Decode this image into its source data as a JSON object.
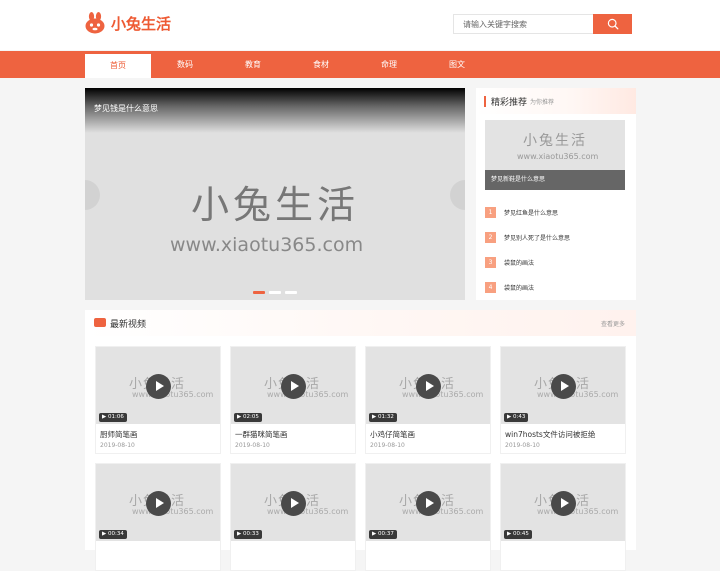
{
  "brand": {
    "name": "小兔生活"
  },
  "search": {
    "placeholder": "请输入关键字搜索"
  },
  "nav": [
    {
      "label": "首页",
      "active": true
    },
    {
      "label": "数码",
      "active": false
    },
    {
      "label": "教育",
      "active": false
    },
    {
      "label": "食材",
      "active": false
    },
    {
      "label": "命理",
      "active": false
    },
    {
      "label": "图文",
      "active": false
    }
  ],
  "slider": {
    "title": "梦见钱是什么意思",
    "watermark": "小兔生活",
    "watermark_url": "www.xiaotu365.com"
  },
  "recommend": {
    "title": "精彩推荐",
    "subtitle": "为你推荐",
    "featured_caption": "梦见新鞋是什么意思",
    "watermark": "小兔生活",
    "watermark_url": "www.xiaotu365.com",
    "items": [
      {
        "num": "1",
        "text": "梦见红鱼是什么意思"
      },
      {
        "num": "2",
        "text": "梦见别人死了是什么意思"
      },
      {
        "num": "3",
        "text": "袋鼠的画法"
      },
      {
        "num": "4",
        "text": "袋鼠的画法"
      }
    ]
  },
  "videos": {
    "title": "最新视频",
    "more": "查看更多",
    "watermark": "小兔生活",
    "watermark_url": "www.xiaotu365.com",
    "items": [
      {
        "duration": "01:06",
        "title": "厨师简笔画",
        "date": "2019-08-10"
      },
      {
        "duration": "02:05",
        "title": "一群猫咪简笔画",
        "date": "2019-08-10"
      },
      {
        "duration": "01:32",
        "title": "小鸡仔简笔画",
        "date": "2019-08-10"
      },
      {
        "duration": "0:43",
        "title": "win7hosts文件访问被拒绝",
        "date": "2019-08-10"
      },
      {
        "duration": "00:34",
        "title": "",
        "date": ""
      },
      {
        "duration": "00:33",
        "title": "",
        "date": ""
      },
      {
        "duration": "00:37",
        "title": "",
        "date": ""
      },
      {
        "duration": "00:45",
        "title": "",
        "date": ""
      }
    ]
  },
  "colors": {
    "accent": "#ee6340",
    "brand_text": "#ee5a33"
  }
}
